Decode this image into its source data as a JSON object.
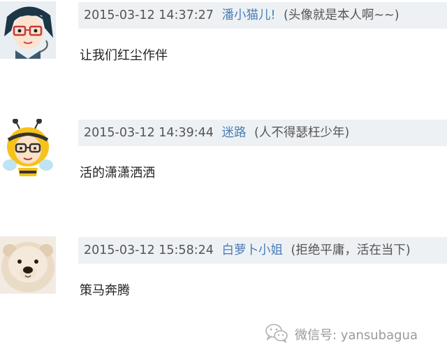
{
  "comments": [
    {
      "date": "2015-03-12 14:37:27",
      "user": "潘小猫儿!",
      "signature": "(头像就是本人啊~~)",
      "text": "让我们红尘作伴",
      "avatar_icon": "cartoon-girl-glasses-avatar"
    },
    {
      "date": "2015-03-12 14:39:44",
      "user": "迷路",
      "signature": "(人不得瑟枉少年)",
      "text": "活的潇潇洒洒",
      "avatar_icon": "bee-costume-boy-avatar"
    },
    {
      "date": "2015-03-12 15:58:24",
      "user": "白萝卜小姐",
      "signature": "(拒绝平庸，活在当下)",
      "text": "策马奔腾",
      "avatar_icon": "chow-chow-puppy-avatar"
    }
  ],
  "watermark": {
    "label": "微信号: yansubagua",
    "icon": "wechat-icon"
  },
  "colors": {
    "header_bg": "#eef1f4",
    "username": "#4a7fb5",
    "meta_text": "#555555",
    "body_text": "#222222",
    "watermark": "#9a9a9a"
  }
}
